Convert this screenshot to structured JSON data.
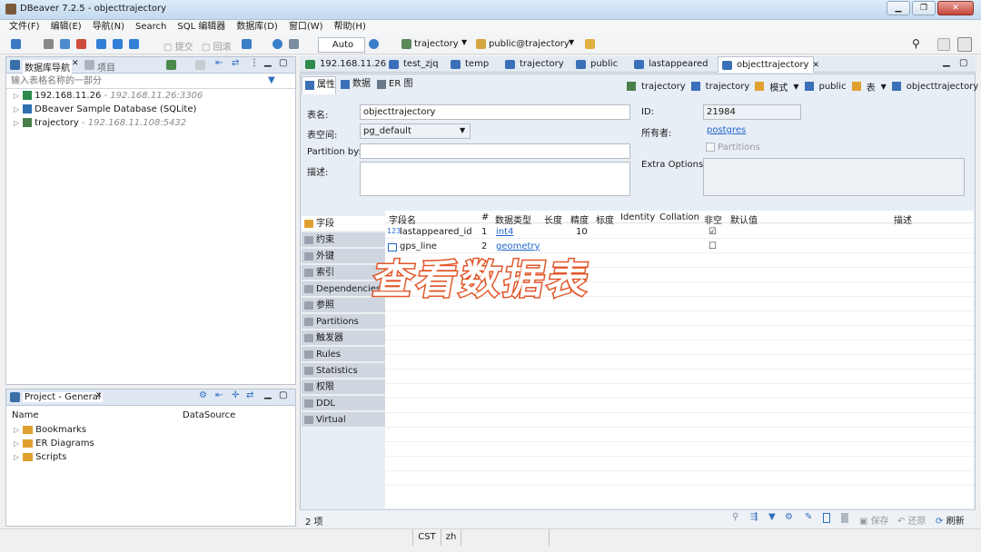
{
  "window": {
    "title": "DBeaver 7.2.5 - objecttrajectory"
  },
  "menu": [
    "文件(F)",
    "编辑(E)",
    "导航(N)",
    "Search",
    "SQL 编辑器",
    "数据库(D)",
    "窗口(W)",
    "帮助(H)"
  ],
  "toolbar": {
    "commit": "提交",
    "rollback": "回滚",
    "mode": "Auto",
    "datasource": "trajectory",
    "schema": "public@trajectory"
  },
  "navigator": {
    "tab_label": "数据库导航",
    "tab2_label": "项目",
    "filter_placeholder": "输入表格名称的一部分",
    "items": [
      {
        "name": "192.168.11.26",
        "detail": "- 192.168.11.26:3306"
      },
      {
        "name": "DBeaver Sample Database (SQLite)",
        "detail": ""
      },
      {
        "name": "trajectory",
        "detail": "- 192.168.11.108:5432"
      }
    ]
  },
  "project": {
    "tab_label": "Project - General",
    "col_name": "Name",
    "col_datasource": "DataSource",
    "items": [
      "Bookmarks",
      "ER Diagrams",
      "Scripts"
    ]
  },
  "editor_tabs": [
    "192.168.11.26",
    "test_zjq",
    "temp",
    "trajectory",
    "public",
    "lastappeared",
    "objecttrajectory"
  ],
  "sub_tabs": [
    "属性",
    "数据",
    "ER 图"
  ],
  "breadcrumb": [
    "trajectory",
    "trajectory",
    "模式",
    "public",
    "表",
    "objecttrajectory"
  ],
  "props": {
    "table_name_label": "表名:",
    "table_name": "objecttrajectory",
    "tablespace_label": "表空间:",
    "tablespace": "pg_default",
    "partition_label": "Partition by:",
    "desc_label": "描述:",
    "id_label": "ID:",
    "id": "21984",
    "owner_label": "所有者:",
    "owner": "postgres",
    "partitions_label": "Partitions",
    "extra_label": "Extra Options:"
  },
  "side_tabs": [
    "字段",
    "约束",
    "外键",
    "索引",
    "Dependencies",
    "参照",
    "Partitions",
    "触发器",
    "Rules",
    "Statistics",
    "权限",
    "DDL",
    "Virtual"
  ],
  "columns_header": [
    "字段名",
    "#",
    "数据类型",
    "长度",
    "精度",
    "标度",
    "Identity",
    "Collation",
    "非空",
    "默认值",
    "描述"
  ],
  "columns_rows": [
    {
      "name": "lastappeared_id",
      "num": "1",
      "type": "int4",
      "precision": "10",
      "notnull": "☑"
    },
    {
      "name": "gps_line",
      "num": "2",
      "type": "geometry",
      "precision": "",
      "notnull": "☐"
    }
  ],
  "footer": {
    "count": "2 项",
    "save": "保存",
    "revert": "还原",
    "refresh": "刷新"
  },
  "statusbar": {
    "tz": "CST",
    "lang": "zh"
  },
  "overlay_text": "查看数据表",
  "colors": {
    "accent": "#e2572a",
    "selected_tab": "#ffffff",
    "link": "#2266cc"
  }
}
